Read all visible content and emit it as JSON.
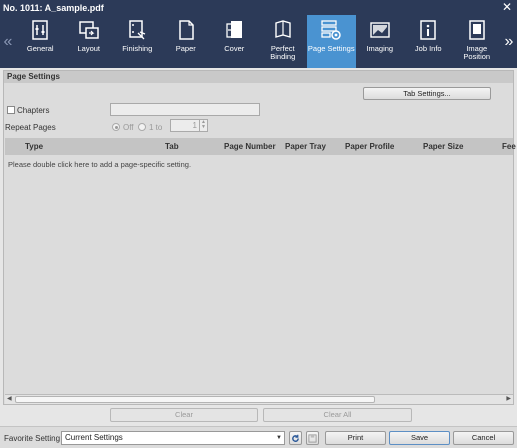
{
  "window": {
    "title": "No. 1011: A_sample.pdf",
    "close_glyph": "✕"
  },
  "toolbar": {
    "scroll_left": "«",
    "scroll_right": "»",
    "tabs": [
      {
        "label": "General",
        "icon": "general-icon"
      },
      {
        "label": "Layout",
        "icon": "layout-icon"
      },
      {
        "label": "Finishing",
        "icon": "finishing-icon"
      },
      {
        "label": "Paper",
        "icon": "paper-icon"
      },
      {
        "label": "Cover",
        "icon": "cover-icon"
      },
      {
        "label": "Perfect\nBinding",
        "icon": "perfect-binding-icon"
      },
      {
        "label": "Page Settings",
        "icon": "page-settings-icon",
        "active": true
      },
      {
        "label": "Imaging",
        "icon": "imaging-icon"
      },
      {
        "label": "Job Info",
        "icon": "job-info-icon"
      },
      {
        "label": "Image\nPosition",
        "icon": "image-position-icon"
      }
    ]
  },
  "page_settings": {
    "section_title": "Page Settings",
    "tab_settings_button": "Tab Settings...",
    "chapters_label": "Chapters",
    "chapters_value": "",
    "repeat_pages_label": "Repeat Pages",
    "off_label": "Off",
    "one_to_label": "1 to",
    "repeat_value": "1",
    "columns": [
      "Type",
      "Tab",
      "Page Number",
      "Paper Tray",
      "Paper Profile",
      "Paper Size",
      "Fee"
    ],
    "empty_hint": "Please double click here to add a page-specific setting.",
    "clear_button": "Clear",
    "clear_all_button": "Clear All"
  },
  "footer": {
    "favorite_label": "Favorite Setting",
    "favorite_value": "Current Settings",
    "print_button": "Print",
    "save_button": "Save",
    "cancel_button": "Cancel"
  },
  "colors": {
    "header_bg": "#2c3a58",
    "active_tab": "#4a93d1"
  }
}
